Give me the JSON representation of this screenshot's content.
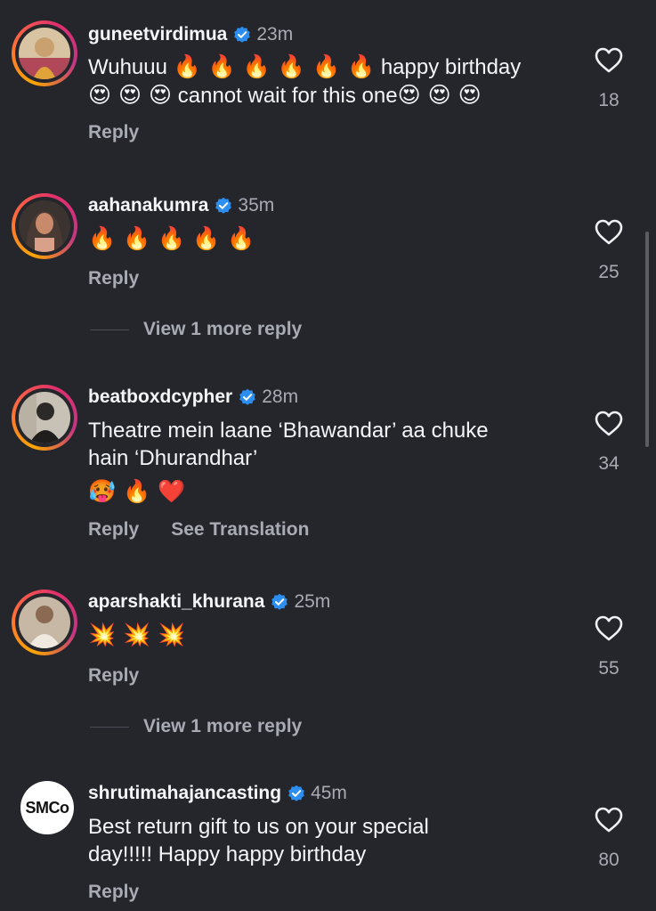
{
  "comments": [
    {
      "username": "guneetvirdimua",
      "time": "23m",
      "text_line1": "Wuhuuu",
      "text_line1_emoji": "🔥 🔥 🔥 🔥 🔥 🔥",
      "text_line1_tail": "happy birthday",
      "text_line2_emoji_lead": "😍 😍 😍",
      "text_line2": "cannot wait for this one",
      "text_line2_emoji_tail": "😍 😍 😍",
      "reply_label": "Reply",
      "likes": "18",
      "avatar_colors": [
        "#c9a070",
        "#b0485a"
      ]
    },
    {
      "username": "aahanakumra",
      "time": "35m",
      "emoji": "🔥 🔥 🔥 🔥 🔥",
      "reply_label": "Reply",
      "likes": "25",
      "view_more": "View 1 more reply",
      "avatar_colors": [
        "#c98a6c",
        "#4a3a34"
      ]
    },
    {
      "username": "beatboxdcypher",
      "time": "28m",
      "text_line1": "Theatre mein laane ‘Bhawandar’ aa chuke",
      "text_line2": "hain ‘Dhurandhar’",
      "emoji": "🥵 🔥 ❤️",
      "reply_label": "Reply",
      "see_translation": "See Translation",
      "likes": "34",
      "avatar_colors": [
        "#c8c2b6",
        "#2b2a28"
      ]
    },
    {
      "username": "aparshakti_khurana",
      "time": "25m",
      "emoji": "💥 💥 💥",
      "reply_label": "Reply",
      "likes": "55",
      "view_more": "View 1 more reply",
      "avatar_colors": [
        "#c7b8a6",
        "#efe9e0"
      ]
    },
    {
      "username": "shrutimahajancasting",
      "time": "45m",
      "avatar_text": "SMCo",
      "text_line1": "Best return gift to us on your special",
      "text_line2": "day!!!!! Happy happy birthday",
      "reply_label": "Reply",
      "likes": "80"
    }
  ],
  "colors": {
    "background": "#24262b",
    "text_primary": "#f4f5f7",
    "text_secondary": "#a8abb3",
    "verified_badge": "#2b8ef0"
  },
  "icons": {
    "verified": "verified-badge-icon",
    "like": "heart-outline-icon"
  }
}
